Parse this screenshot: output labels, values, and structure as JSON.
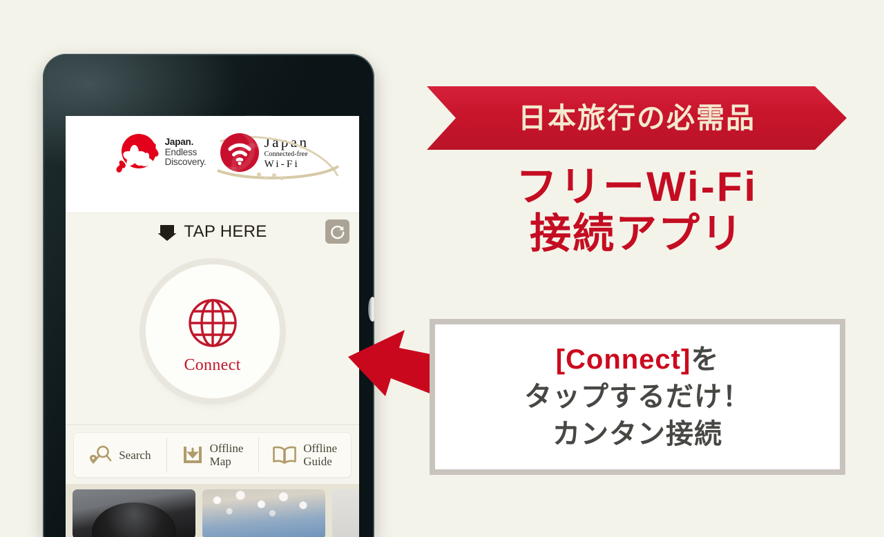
{
  "colors": {
    "page_background": "#f4f3ea",
    "brand_red": "#c40d22",
    "ribbon_red": "#c8152c",
    "ribbon_text": "#f3e9cf",
    "callout_border": "#c9c3be",
    "callout_text": "#474744",
    "accent_gold": "#b09b6a",
    "app_background": "#f6f5ed"
  },
  "phone": {
    "earpiece": "earpiece-speaker",
    "front_camera": "front-camera",
    "power_button": "power-button"
  },
  "app": {
    "header": {
      "logo_jed": {
        "mark": "japan-rising-sun-sakura-logo",
        "line1": "Japan.",
        "line2": "Endless",
        "line3": "Discovery."
      },
      "logo_wifi": {
        "mark": "wifi-signal-logo",
        "line1": "Japan",
        "line2": "Connected-free",
        "line3": "Wi-Fi"
      }
    },
    "tap_row": {
      "arrow_icon": "arrow-down-icon",
      "label": "TAP HERE",
      "refresh_icon": "refresh-icon"
    },
    "connect": {
      "icon": "globe-icon",
      "label": "Connect"
    },
    "toolbar": [
      {
        "icon": "map-pin-search-icon",
        "label_line1": "Search",
        "label_line2": ""
      },
      {
        "icon": "download-tray-icon",
        "label_line1": "Offline",
        "label_line2": "Map"
      },
      {
        "icon": "open-book-icon",
        "label_line1": "Offline",
        "label_line2": "Guide"
      }
    ],
    "thumbnails": [
      {
        "name": "thumbnail-dark"
      },
      {
        "name": "thumbnail-cherry-blossom"
      },
      {
        "name": "thumbnail-light"
      }
    ]
  },
  "promo": {
    "ribbon": "日本旅行の必需品",
    "headline_line1": "フリーWi-Fi",
    "headline_line2": "接続アプリ",
    "callout": {
      "line1_highlight": "[Connect]",
      "line1_rest": "を",
      "line2": "タップするだけ！",
      "line3": "カンタン接続"
    },
    "arrow_icon": "arrow-pointing-to-connect-button"
  }
}
